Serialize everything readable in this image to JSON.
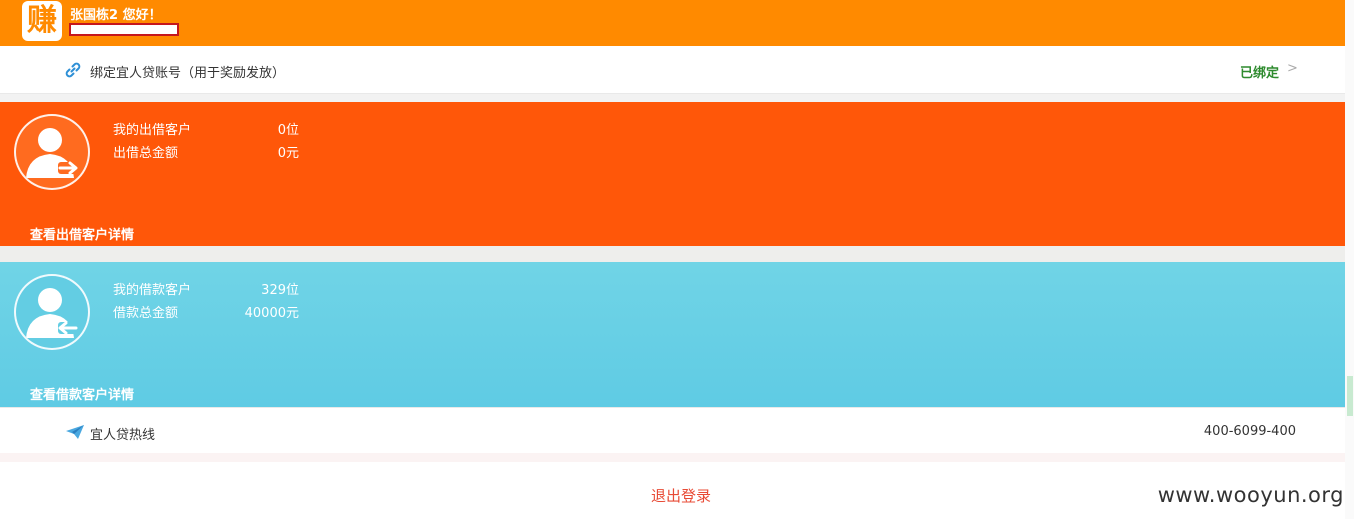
{
  "header": {
    "logo_char": "赚",
    "greeting": "张国栋2 您好！"
  },
  "bind": {
    "label": "绑定宜人贷账号（用于奖励发放）",
    "status": "已绑定",
    "chevron": ">",
    "icon": "link-icon"
  },
  "lend": {
    "customers_label": "我的出借客户",
    "customers_value": "0位",
    "amount_label": "出借总金额",
    "amount_value": "0元",
    "detail_link": "查看出借客户详情",
    "icon": "user-arrow-out-icon"
  },
  "borrow": {
    "customers_label": "我的借款客户",
    "customers_value": "329位",
    "amount_label": "借款总金额",
    "amount_value": "40000元",
    "detail_link": "查看借款客户详情",
    "icon": "user-arrow-in-icon"
  },
  "hotline": {
    "label": "宜人贷热线",
    "phone": "400-6099-400",
    "icon": "paper-plane-icon"
  },
  "logout_label": "退出登录",
  "watermark": "www.wooyun.org",
  "colors": {
    "header": "#ff8a00",
    "lend_panel": "#ff5709",
    "borrow_panel": "#63cde3",
    "bound_status": "#2e8b2e",
    "logout": "#e84b36"
  }
}
